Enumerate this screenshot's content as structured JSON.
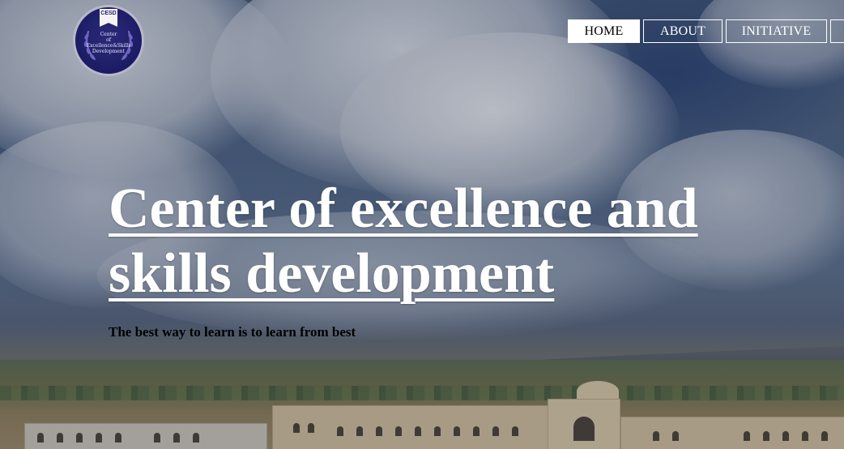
{
  "logo": {
    "badge": "CESD",
    "line1": "Center",
    "line2": "of",
    "line3": "Excellence&Skills",
    "line4": "Development"
  },
  "nav": {
    "items": [
      {
        "label": "HOME",
        "active": true
      },
      {
        "label": "ABOUT",
        "active": false
      },
      {
        "label": "INITIATIVE",
        "active": false
      },
      {
        "label": "",
        "active": false
      }
    ]
  },
  "hero": {
    "headline": "Center of excellence and skills development",
    "tagline": "The best way to learn is to learn from best"
  },
  "colors": {
    "nav_border": "#ffffff",
    "nav_active_bg": "#ffffff",
    "headline_text": "#ffffff",
    "tagline_text": "#000000",
    "logo_bg": "#1d1d66"
  },
  "icons": {
    "logo": "laurel-wreath-emblem"
  }
}
